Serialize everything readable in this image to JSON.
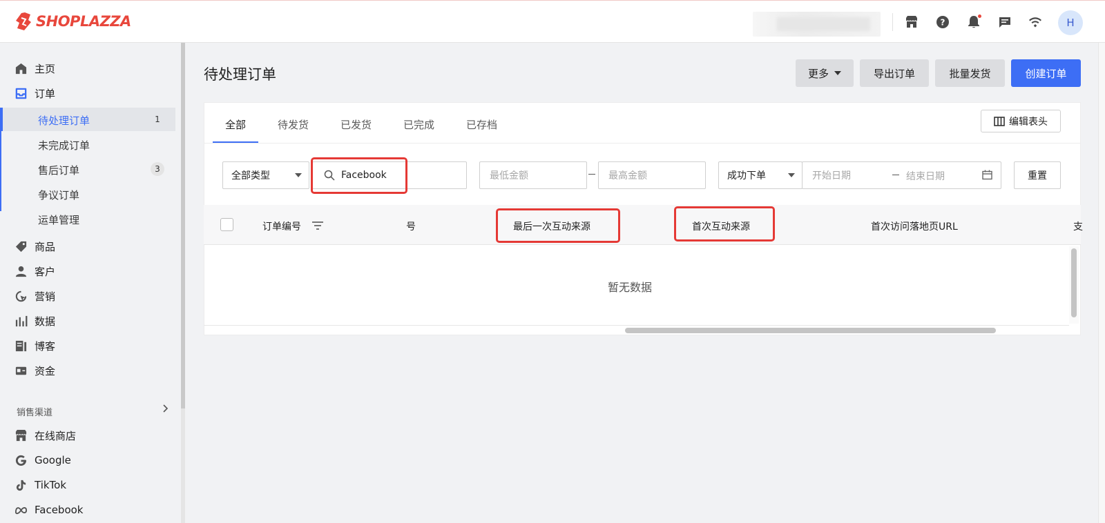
{
  "brand": {
    "name": "SHOPLAZZA",
    "color": "#e8473c"
  },
  "user": {
    "avatar_initial": "H"
  },
  "header_icons": [
    "store-icon",
    "help-icon",
    "bell-icon",
    "chat-icon",
    "wifi-icon"
  ],
  "sidebar": {
    "items": [
      {
        "label": "主页",
        "icon": "home-icon"
      },
      {
        "label": "订单",
        "icon": "orders-icon"
      },
      {
        "label": "商品",
        "icon": "tag-icon"
      },
      {
        "label": "客户",
        "icon": "person-icon"
      },
      {
        "label": "营销",
        "icon": "marketing-icon"
      },
      {
        "label": "数据",
        "icon": "bar-chart-icon"
      },
      {
        "label": "博客",
        "icon": "blog-icon"
      },
      {
        "label": "资金",
        "icon": "wallet-icon"
      }
    ],
    "order_subitems": [
      {
        "label": "待处理订单",
        "badge": "1",
        "active": true
      },
      {
        "label": "未完成订单"
      },
      {
        "label": "售后订单",
        "badge": "3"
      },
      {
        "label": "争议订单"
      },
      {
        "label": "运单管理"
      }
    ],
    "channels_label": "销售渠道",
    "channels": [
      {
        "label": "在线商店",
        "icon": "store-icon"
      },
      {
        "label": "Google",
        "icon": "google-icon"
      },
      {
        "label": "TikTok",
        "icon": "tiktok-icon"
      },
      {
        "label": "Facebook",
        "icon": "meta-icon"
      }
    ]
  },
  "page": {
    "title": "待处理订单",
    "buttons": {
      "more": "更多",
      "export": "导出订单",
      "bulk_ship": "批量发货",
      "create": "创建订单"
    },
    "accent": "#3d6ef5"
  },
  "tabs": [
    {
      "label": "全部",
      "active": true
    },
    {
      "label": "待发货"
    },
    {
      "label": "已发货"
    },
    {
      "label": "已完成"
    },
    {
      "label": "已存档"
    }
  ],
  "edit_columns_label": "编辑表头",
  "filters": {
    "type_select": "全部类型",
    "search_value": "Facebook",
    "min_amount_placeholder": "最低金额",
    "max_amount_placeholder": "最高金额",
    "status_select": "成功下单",
    "start_date_placeholder": "开始日期",
    "end_date_placeholder": "结束日期",
    "reset_label": "重置"
  },
  "table": {
    "columns": [
      "订单编号",
      "号",
      "最后一次互动来源",
      "首次互动来源",
      "首次访问落地页URL",
      "支"
    ],
    "empty_text": "暂无数据"
  }
}
